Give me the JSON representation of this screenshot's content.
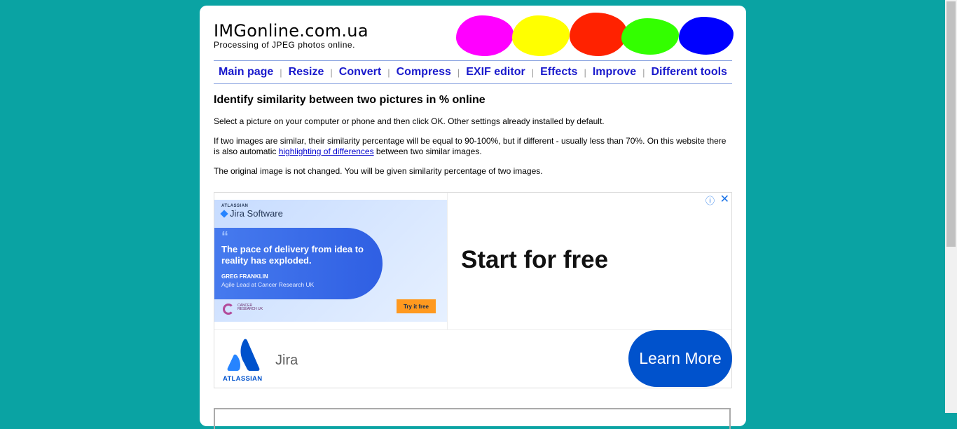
{
  "site": {
    "title": "IMGonline.com.ua",
    "subtitle": "Processing of JPEG photos online."
  },
  "logo_blobs": [
    "#ff00ff",
    "#ffff00",
    "#ff2200",
    "#33ff00",
    "#0000ff"
  ],
  "nav": {
    "items": [
      {
        "label": "Main page"
      },
      {
        "label": "Resize"
      },
      {
        "label": "Convert"
      },
      {
        "label": "Compress"
      },
      {
        "label": "EXIF editor"
      },
      {
        "label": "Effects"
      },
      {
        "label": "Improve"
      },
      {
        "label": "Different tools"
      }
    ],
    "separator": "|"
  },
  "main": {
    "heading": "Identify similarity between two pictures in % online",
    "p1": "Select a picture on your computer or phone and then click OK. Other settings already installed by default.",
    "p2_before": "If two images are similar, their similarity percentage will be equal to 90-100%, but if different - usually less than 70%. On this website there is also automatic ",
    "p2_link": "highlighting of differences",
    "p2_after": " between two similar images.",
    "p3": "The original image is not changed. You will be given similarity percentage of two images."
  },
  "ad": {
    "image": {
      "brand_small": "ATLASSIAN",
      "brand": "Jira Software",
      "quote_mark": "“",
      "quote": "The pace of delivery from idea to reality has exploded.",
      "person": "GREG FRANKLIN",
      "role": "Agile Lead at Cancer Research UK",
      "partner": "CANCER RESEARCH UK",
      "cta": "Try it free"
    },
    "headline": "Start for free",
    "info_icon": "ⓘ",
    "close_icon": "✕",
    "logo_text": "ATLASSIAN",
    "product": "Jira",
    "button": "Learn More"
  }
}
